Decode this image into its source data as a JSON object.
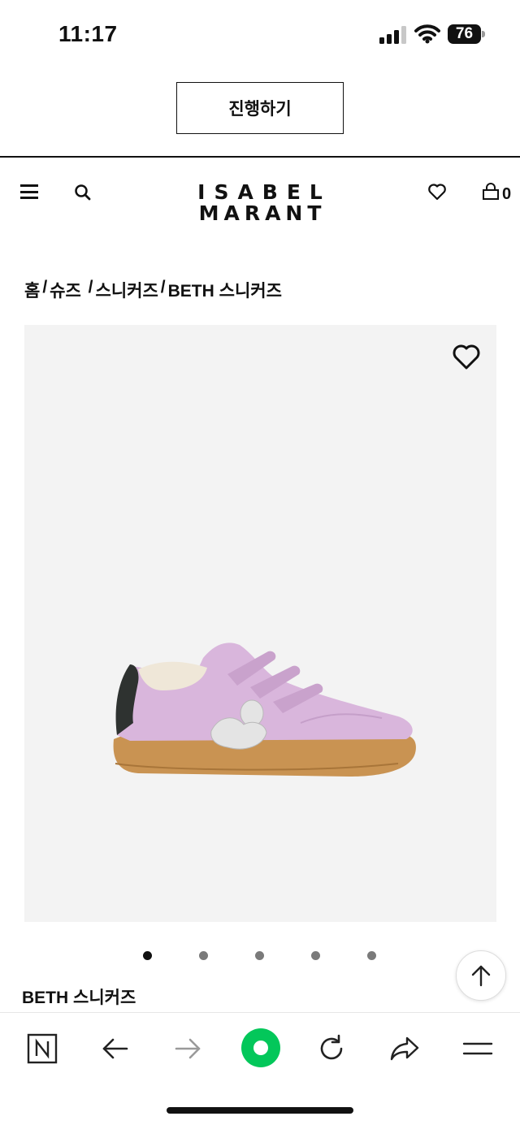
{
  "status_bar": {
    "time": "11:17",
    "battery": "76"
  },
  "banner": {
    "proceed_label": "진행하기"
  },
  "header": {
    "logo_line1": "ISABEL",
    "logo_line2": "MARANT",
    "bag_count": "0"
  },
  "breadcrumb": [
    {
      "label": "홈"
    },
    {
      "label": "슈즈 "
    },
    {
      "label": "스니커즈"
    },
    {
      "label": "BETH 스니커즈"
    }
  ],
  "breadcrumb_separator": "/",
  "product": {
    "name": "BETH 스니커즈",
    "image_count": 5,
    "active_image": 1
  },
  "icons": {
    "menu": "menu-icon",
    "search": "search-icon",
    "wishlist": "heart-icon",
    "bag": "bag-icon",
    "favorite": "heart-outline-icon",
    "scroll_top": "arrow-up-icon",
    "browser_home": "naver-n-icon",
    "back": "arrow-left-icon",
    "forward": "arrow-right-icon",
    "green": "green-circle-icon",
    "reload": "reload-icon",
    "share": "share-icon",
    "more": "hamburger-icon"
  },
  "colors": {
    "image_bg": "#f3f3f3",
    "accent_green": "#03c75a"
  }
}
